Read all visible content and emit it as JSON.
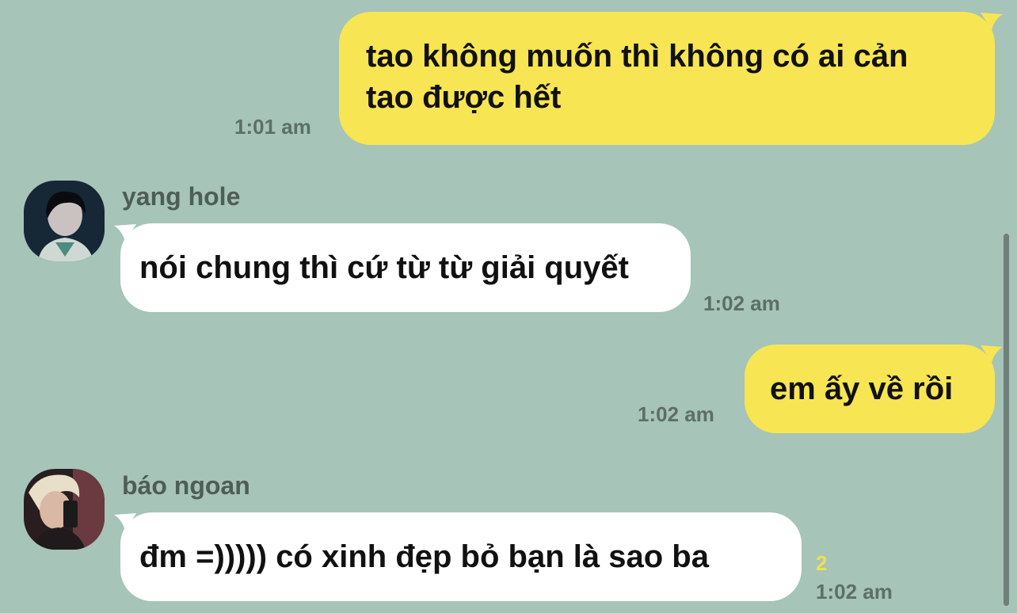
{
  "messages": [
    {
      "side": "mine",
      "lines": [
        "tao không muốn thì không có ai cản",
        "tao được hết"
      ],
      "time": "1:01 am"
    },
    {
      "side": "theirs",
      "sender": "yang hole",
      "text": "nói chung thì cứ từ từ giải quyết",
      "time": "1:02 am"
    },
    {
      "side": "mine",
      "text": "em ấy về rồi",
      "time": "1:02 am"
    },
    {
      "side": "theirs",
      "sender": "báo ngoan",
      "text": "đm =))))) có xinh đẹp bỏ bạn là sao ba",
      "time": "1:02 am",
      "unread_count": "2"
    }
  ],
  "colors": {
    "background": "#a6c4b8",
    "my_bubble": "#f7e553",
    "their_bubble": "#ffffff",
    "timestamp": "#5d6f67",
    "unread": "#f4e04d"
  },
  "icons": {
    "avatar_1": "avatar-yang-hole",
    "avatar_2": "avatar-bao-ngoan"
  }
}
